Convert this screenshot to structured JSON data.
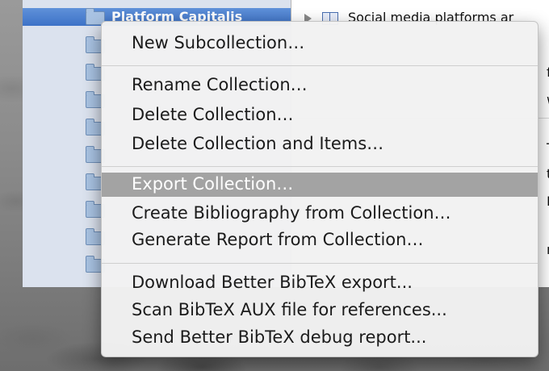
{
  "sidebar": {
    "selected_collection": "Platform Capitalis"
  },
  "items": [
    {
      "text": "Social media platforms ar"
    },
    {
      "text": "fo"
    },
    {
      "text": "w"
    },
    {
      "text": "TC"
    },
    {
      "text": "ta"
    },
    {
      "text": "Bi"
    },
    {
      "text": "ns"
    }
  ],
  "context_menu": {
    "new_subcollection": "New Subcollection…",
    "rename_collection": "Rename Collection…",
    "delete_collection": "Delete Collection…",
    "delete_collection_and_items": "Delete Collection and Items…",
    "export_collection": "Export Collection…",
    "create_bibliography": "Create Bibliography from Collection…",
    "generate_report": "Generate Report from Collection…",
    "download_bbt_export": "Download Better BibTeX export...",
    "scan_bibtex_aux": "Scan BibTeX AUX file for references...",
    "send_bbt_debug": "Send Better BibTeX debug report..."
  },
  "highlighted_item": "Export Collection…",
  "colors": {
    "selection": "#3d72c7",
    "menu_highlight": "#a3a3a3",
    "sidebar_bg": "#dbe2ee"
  }
}
